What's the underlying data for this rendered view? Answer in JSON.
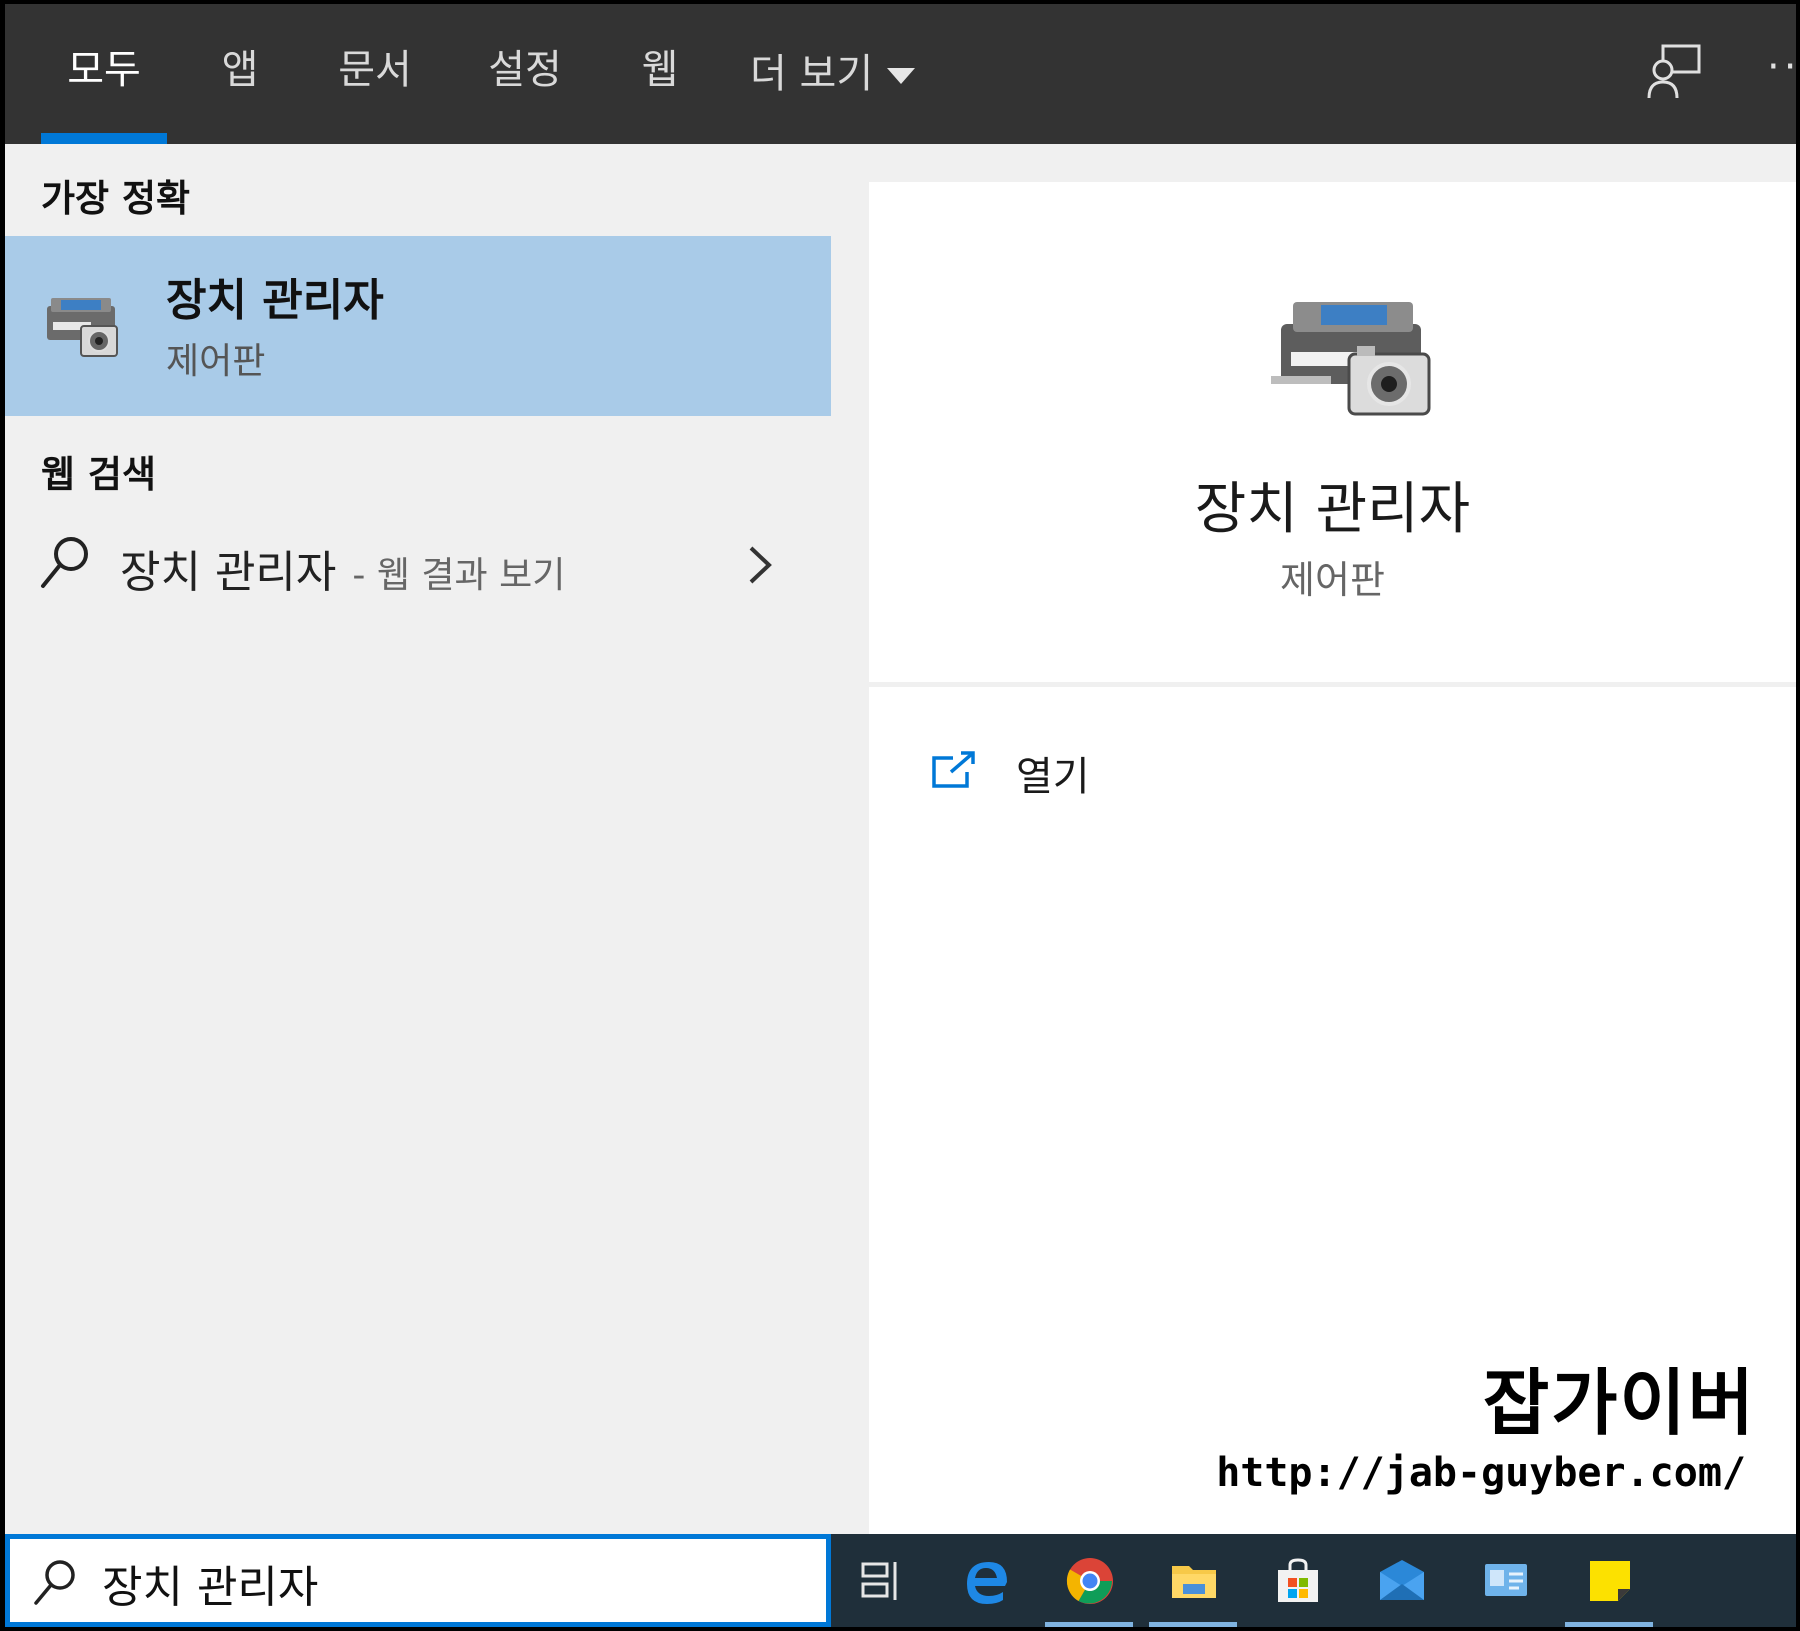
{
  "tabs": [
    {
      "label": "모두",
      "active": true
    },
    {
      "label": "앱",
      "active": false
    },
    {
      "label": "문서",
      "active": false
    },
    {
      "label": "설정",
      "active": false
    },
    {
      "label": "웹",
      "active": false
    }
  ],
  "more_tab": {
    "label": "더 보기",
    "icon": "caret-down-icon"
  },
  "topbar_icons": [
    "feedback-icon",
    "more-options-icon"
  ],
  "best_match": {
    "heading": "가장 정확",
    "title": "장치 관리자",
    "subtitle": "제어판",
    "icon": "device-manager-icon"
  },
  "web_search": {
    "heading": "웹 검색",
    "query": "장치 관리자",
    "suffix": "- 웹 결과 보기",
    "icon": "search-icon"
  },
  "preview": {
    "title": "장치 관리자",
    "subtitle": "제어판",
    "icon": "device-manager-icon"
  },
  "actions": [
    {
      "label": "열기",
      "icon": "open-external-icon"
    }
  ],
  "watermark": {
    "title": "잡가이버",
    "url": "http://jab-guyber.com/"
  },
  "search_box": {
    "value": "장치 관리자",
    "icon": "search-icon"
  },
  "taskbar": {
    "items": [
      {
        "icon": "task-view-icon",
        "running": false
      },
      {
        "icon": "edge-icon",
        "running": false
      },
      {
        "icon": "chrome-icon",
        "running": true
      },
      {
        "icon": "file-explorer-icon",
        "running": true
      },
      {
        "icon": "store-icon",
        "running": false
      },
      {
        "icon": "mail-icon",
        "running": false
      },
      {
        "icon": "contacts-card-icon",
        "running": false
      },
      {
        "icon": "sticky-notes-icon",
        "running": true
      }
    ]
  },
  "colors": {
    "topbar_bg": "#333333",
    "accent": "#0078d7",
    "selection": "#a9cbe8",
    "panel_bg": "#f0f0f0",
    "taskbar_bg": "#1f2f3a"
  }
}
